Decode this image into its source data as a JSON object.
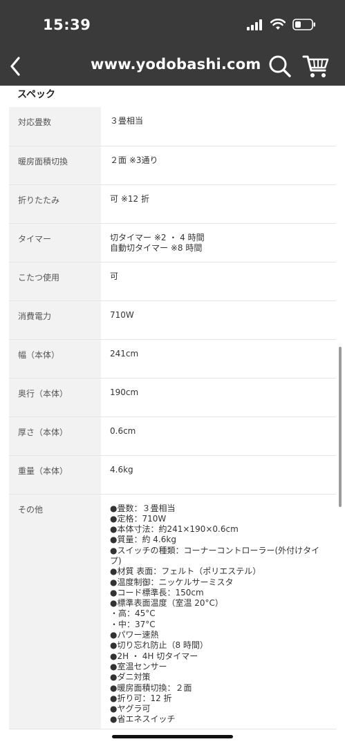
{
  "status_bar": {
    "time": "15:39"
  },
  "nav": {
    "site_title": "www.yodobashi.com",
    "icons": [
      "back-chevron-icon",
      "search-icon",
      "cart-icon"
    ]
  },
  "section": {
    "title": "スペック"
  },
  "specs": [
    {
      "label": "対応畳数",
      "value": "３畳相当"
    },
    {
      "label": "暖房面積切換",
      "value": "２面 ※3通り"
    },
    {
      "label": "折りたたみ",
      "value": "可 ※12 折"
    },
    {
      "label": "タイマー",
      "value": "切タイマー ※2 ・ 4 時間\n自動切タイマー ※8 時間"
    },
    {
      "label": "こたつ使用",
      "value": "可"
    },
    {
      "label": "消費電力",
      "value": "710W"
    },
    {
      "label": "幅（本体）",
      "value": "241cm"
    },
    {
      "label": "奥行（本体）",
      "value": "190cm"
    },
    {
      "label": "厚さ（本体）",
      "value": "0.6cm"
    },
    {
      "label": "重量（本体）",
      "value": "4.6kg"
    }
  ],
  "other": {
    "label": "その他",
    "lines": [
      "●畳数：３畳相当",
      "●定格：710W",
      "●本体寸法：約241×190×0.6cm",
      "●質量：約 4.6kg",
      "●スイッチの種類：コーナーコントローラー(外付けタイ",
      "プ)",
      "●材質 表面：フェルト（ポリエステル）",
      "●温度制御：ニッケルサーミスタ",
      "●コード標準長：150cm",
      "●標準表面温度（室温 20°C）",
      "・高：45°C",
      "・中：37°C",
      "●パワー速熱",
      "●切り忘れ防止（8 時間）",
      "●2H ・ 4H 切タイマー",
      "●室温センサー",
      "●ダニ対策",
      "●暖房面積切換：２面",
      "●折り可：12 折",
      "●ヤグラ可",
      "●省エネスイッチ"
    ]
  }
}
